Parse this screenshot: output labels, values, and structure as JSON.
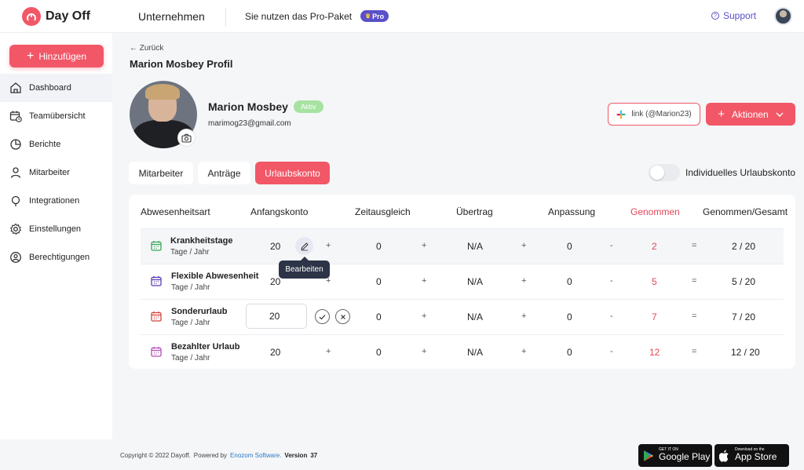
{
  "app": {
    "name": "Day Off"
  },
  "header": {
    "company": "Unternehmen",
    "plan_text": "Sie nutzen das Pro-Paket",
    "pro_badge": "Pro",
    "support": "Support"
  },
  "sidebar": {
    "add_button": "Hinzufügen",
    "items": [
      {
        "label": "Dashboard",
        "icon": "home-icon"
      },
      {
        "label": "Teamübersicht",
        "icon": "calendar-clock-icon"
      },
      {
        "label": "Berichte",
        "icon": "pie-chart-icon"
      },
      {
        "label": "Mitarbeiter",
        "icon": "user-icon"
      },
      {
        "label": "Integrationen",
        "icon": "plug-icon"
      },
      {
        "label": "Einstellungen",
        "icon": "gear-icon"
      },
      {
        "label": "Berechtigungen",
        "icon": "user-shield-icon"
      }
    ]
  },
  "profile": {
    "back": "← Zurück",
    "title": "Marion Mosbey Profil",
    "name": "Marion Mosbey",
    "status": "Aktiv",
    "email": "marimog23@gmail.com",
    "slack_button": "link (@Marion23)",
    "actions_button": "Aktionen"
  },
  "tabs": [
    "Mitarbeiter",
    "Anträge",
    "Urlaubskonto"
  ],
  "toggle_label": "Individuelles Urlaubskonto",
  "table": {
    "headers": [
      "Abwesenheitsart",
      "Anfangskonto",
      "Zeitausgleich",
      "Übertrag",
      "Anpassung",
      "Genommen",
      "Genommen/Gesamt"
    ],
    "operators": {
      "plus": "+",
      "minus": "-",
      "equals": "="
    },
    "rows": [
      {
        "name": "Krankheitstage",
        "unit": "Tage / Jahr",
        "start": "20",
        "comp": "0",
        "carry": "N/A",
        "adjust": "0",
        "taken": "2",
        "ratio": "2 / 20",
        "icon_color": "#3aa657"
      },
      {
        "name": "Flexible Abwesenheit",
        "unit": "Tage / Jahr",
        "start": "20",
        "comp": "0",
        "carry": "N/A",
        "adjust": "0",
        "taken": "5",
        "ratio": "5 / 20",
        "icon_color": "#5a3fb0"
      },
      {
        "name": "Sonderurlaub",
        "unit": "Tage / Jahr",
        "start": "20",
        "comp": "0",
        "carry": "N/A",
        "adjust": "0",
        "taken": "7",
        "ratio": "7 / 20",
        "icon_color": "#d2453f"
      },
      {
        "name": "Bezahlter Urlaub",
        "unit": "Tage / Jahr",
        "start": "20",
        "comp": "0",
        "carry": "N/A",
        "adjust": "0",
        "taken": "12",
        "ratio": "12 / 20",
        "icon_color": "#b34fb8"
      }
    ],
    "tooltip": "Bearbeiten"
  },
  "footer": {
    "copyright": "Copyright © 2022 Dayoff.",
    "powered": "Powered by",
    "company_link": "Enozom Software.",
    "version_label": "Version",
    "version": "37"
  },
  "stores": {
    "google_small": "GET IT ON",
    "google_big": "Google Play",
    "apple_small": "Download on the",
    "apple_big": "App Store"
  },
  "colors": {
    "accent": "#f25767",
    "pro": "#5a50c8",
    "active_badge": "#a6e3a1",
    "taken": "#e2465a"
  }
}
